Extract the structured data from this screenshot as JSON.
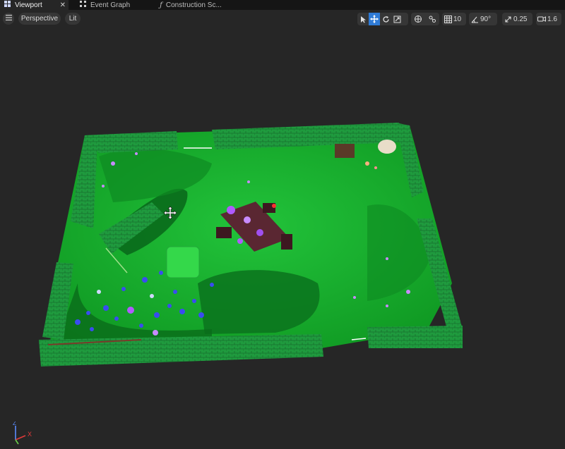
{
  "tabs": [
    {
      "label": "Viewport",
      "icon": "viewport-grid-icon",
      "active": true
    },
    {
      "label": "Event Graph",
      "icon": "graph-nodes-icon",
      "active": false
    },
    {
      "label": "Construction Sc...",
      "icon": "function-icon",
      "active": false
    }
  ],
  "toolbar": {
    "view_mode": "Perspective",
    "lighting_mode": "Lit",
    "grid_snap": "10",
    "rotation_snap": "90°",
    "scale_snap": "0.25",
    "camera_speed": "1.6",
    "tools": [
      {
        "name": "select-icon",
        "selected": false
      },
      {
        "name": "translate-icon",
        "selected": true
      },
      {
        "name": "rotate-icon",
        "selected": false
      },
      {
        "name": "scale-icon",
        "selected": false
      }
    ]
  },
  "axis_gizmo": {
    "x_label": "X",
    "z_label": "Z"
  },
  "colors": {
    "tab_bar": "#151515",
    "background": "#262626",
    "accent": "#2f7bd6",
    "grass": "#17b52a",
    "hedge": "#1e9b3a"
  }
}
